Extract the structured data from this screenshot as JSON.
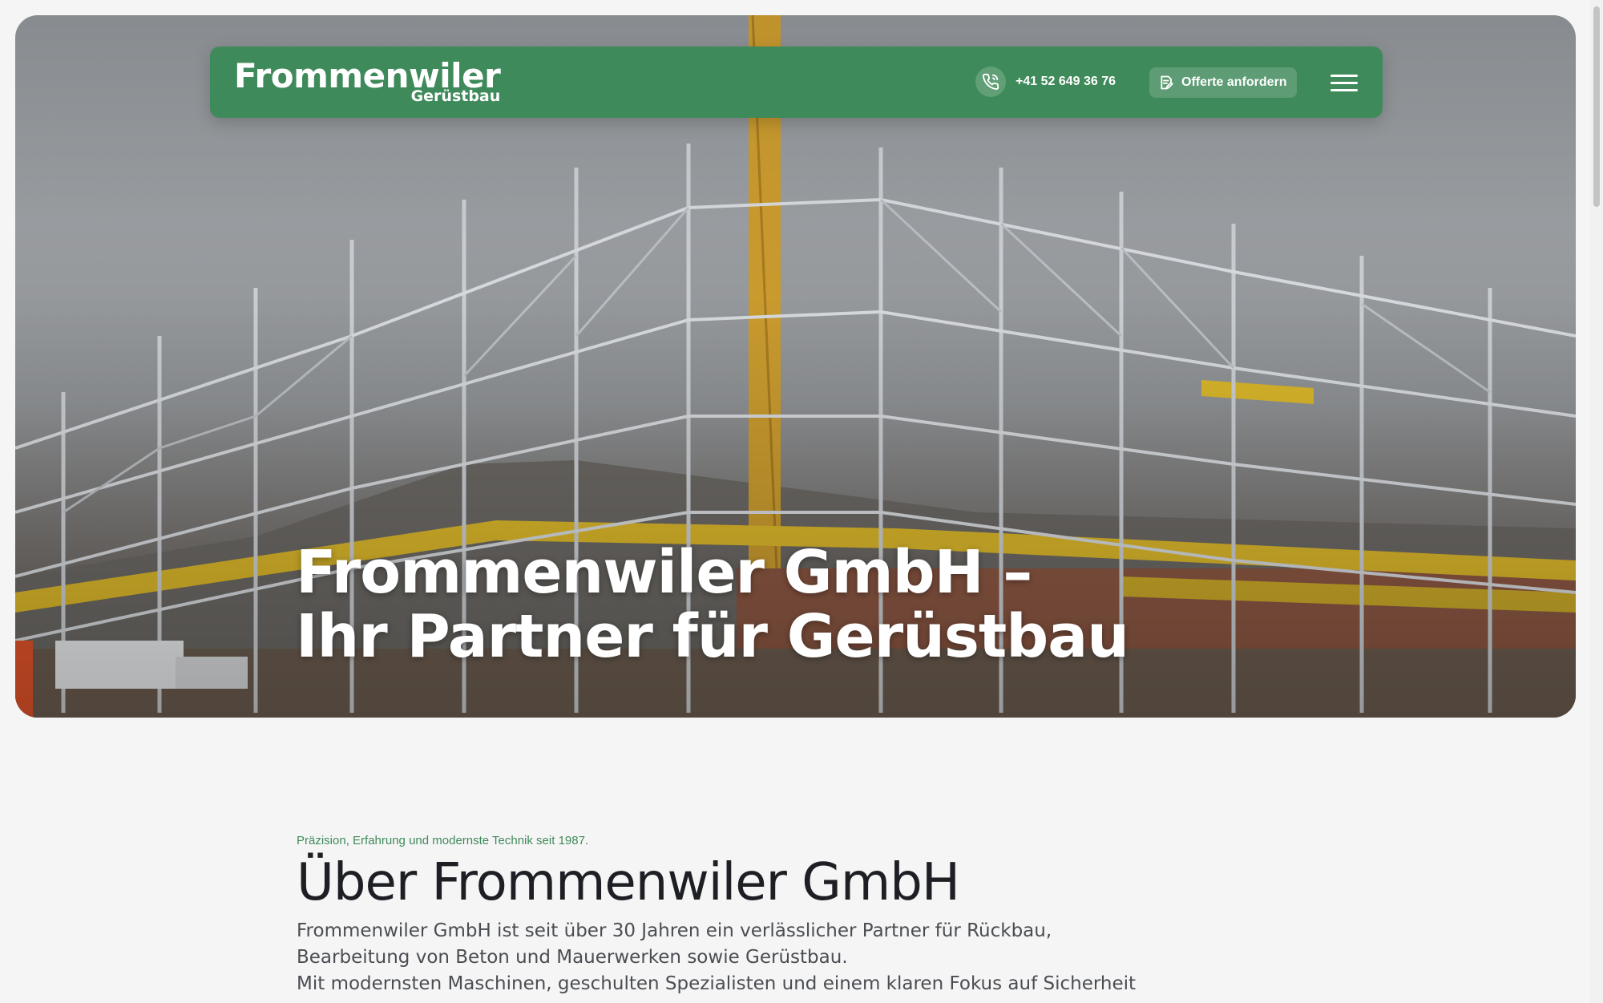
{
  "header": {
    "logo_main": "Frommenwiler",
    "logo_sub": "Gerüstbau",
    "phone": "+41 52 649 36 76",
    "offer_label": "Offerte anfordern",
    "menu_icon": "hamburger-menu-icon",
    "phone_icon": "phone-icon",
    "offer_icon": "document-edit-icon"
  },
  "hero": {
    "title_line1": "Frommenwiler GmbH –",
    "title_line2": "Ihr Partner für Gerüstbau"
  },
  "about": {
    "eyebrow": "Präzision, Erfahrung und modernste Technik seit 1987.",
    "title": "Über Frommenwiler GmbH",
    "body_line1": "Frommenwiler GmbH ist seit über 30 Jahren ein verlässlicher Partner für Rückbau,",
    "body_line2": "Bearbeitung von Beton und Mauerwerken sowie Gerüstbau.",
    "body_line3": "Mit modernsten Maschinen, geschulten Spezialisten und einem klaren Fokus auf Sicherheit"
  },
  "colors": {
    "brand_green": "#3f8a5a",
    "heading_dark": "#1d1f24",
    "body_text": "#4a4d52",
    "page_background": "#f5f5f5"
  }
}
